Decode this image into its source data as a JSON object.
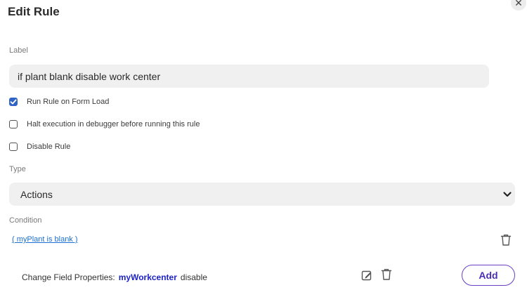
{
  "dialog": {
    "title": "Edit Rule",
    "close_symbol": "✕"
  },
  "label_section": {
    "heading": "Label",
    "value": "if plant blank disable work center"
  },
  "options": [
    {
      "label": "Run Rule on Form Load",
      "checked": true
    },
    {
      "label": "Halt execution in debugger before running this rule",
      "checked": false
    },
    {
      "label": "Disable Rule",
      "checked": false
    }
  ],
  "type_section": {
    "heading": "Type",
    "selected": "Actions"
  },
  "condition_section": {
    "heading": "Condition",
    "expression": "( myPlant is blank )"
  },
  "action": {
    "prefix": "Change Field Properties:",
    "field": "myWorkcenter",
    "property": "disable"
  },
  "buttons": {
    "add_label": "Add"
  },
  "icons": {
    "close": "close-icon",
    "chevron": "chevron-down-icon",
    "trash": "trash-icon",
    "edit": "edit-icon"
  },
  "colors": {
    "checkbox_checked": "#2f64c6",
    "link": "#1a6fd0",
    "variable": "#1c22c8",
    "add_button_border": "#6a3fc2"
  }
}
